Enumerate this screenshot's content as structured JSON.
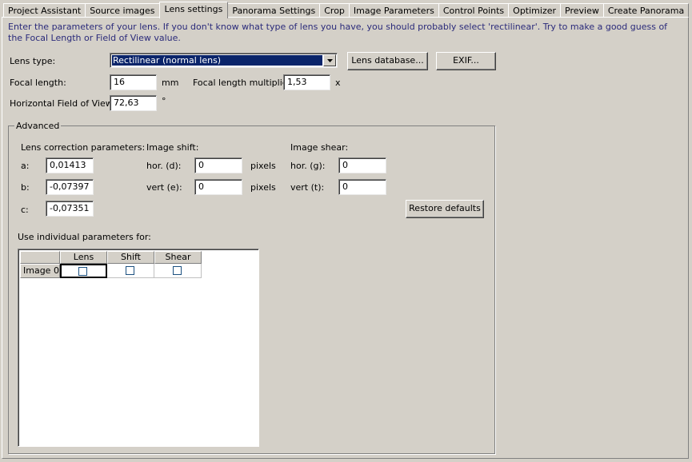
{
  "tabs": [
    {
      "label": "Project Assistant"
    },
    {
      "label": "Source images"
    },
    {
      "label": "Lens settings"
    },
    {
      "label": "Panorama Settings"
    },
    {
      "label": "Crop"
    },
    {
      "label": "Image Parameters"
    },
    {
      "label": "Control Points"
    },
    {
      "label": "Optimizer"
    },
    {
      "label": "Preview"
    },
    {
      "label": "Create Panorama"
    }
  ],
  "active_tab": "Lens settings",
  "intro_text": "Enter the parameters of your lens. If you don't know what type of lens you have, you should probably select 'rectilinear'. Try to make a good guess of the Focal Length or Field of View value.",
  "lens": {
    "type_label": "Lens type:",
    "type_value": "Rectilinear (normal lens)",
    "database_button": "Lens database...",
    "exif_button": "EXIF...",
    "focal_length_label": "Focal length:",
    "focal_length_value": "16",
    "focal_length_unit": "mm",
    "multiplier_label": "Focal length multiplier:",
    "multiplier_value": "1,53",
    "multiplier_unit": "x",
    "hfov_label": "Horizontal Field of View:",
    "hfov_value": "72,63",
    "hfov_unit": "°"
  },
  "advanced": {
    "title": "Advanced",
    "correction_label": "Lens correction parameters:",
    "a_label": "a:",
    "a_value": "0,01413",
    "b_label": "b:",
    "b_value": "-0,07397",
    "c_label": "c:",
    "c_value": "-0,07351",
    "shift_label": "Image shift:",
    "shift_d_label": "hor. (d):",
    "shift_d_value": "0",
    "shift_e_label": "vert (e):",
    "shift_e_value": "0",
    "shift_unit": "pixels",
    "shear_label": "Image shear:",
    "shear_g_label": "hor. (g):",
    "shear_g_value": "0",
    "shear_t_label": "vert (t):",
    "shear_t_value": "0",
    "restore_button": "Restore defaults",
    "individual_label": "Use individual parameters for:",
    "grid": {
      "columns": [
        "Lens",
        "Shift",
        "Shear"
      ],
      "rows": [
        {
          "label": "Image 0",
          "lens": false,
          "shift": false,
          "shear": false
        }
      ]
    }
  }
}
